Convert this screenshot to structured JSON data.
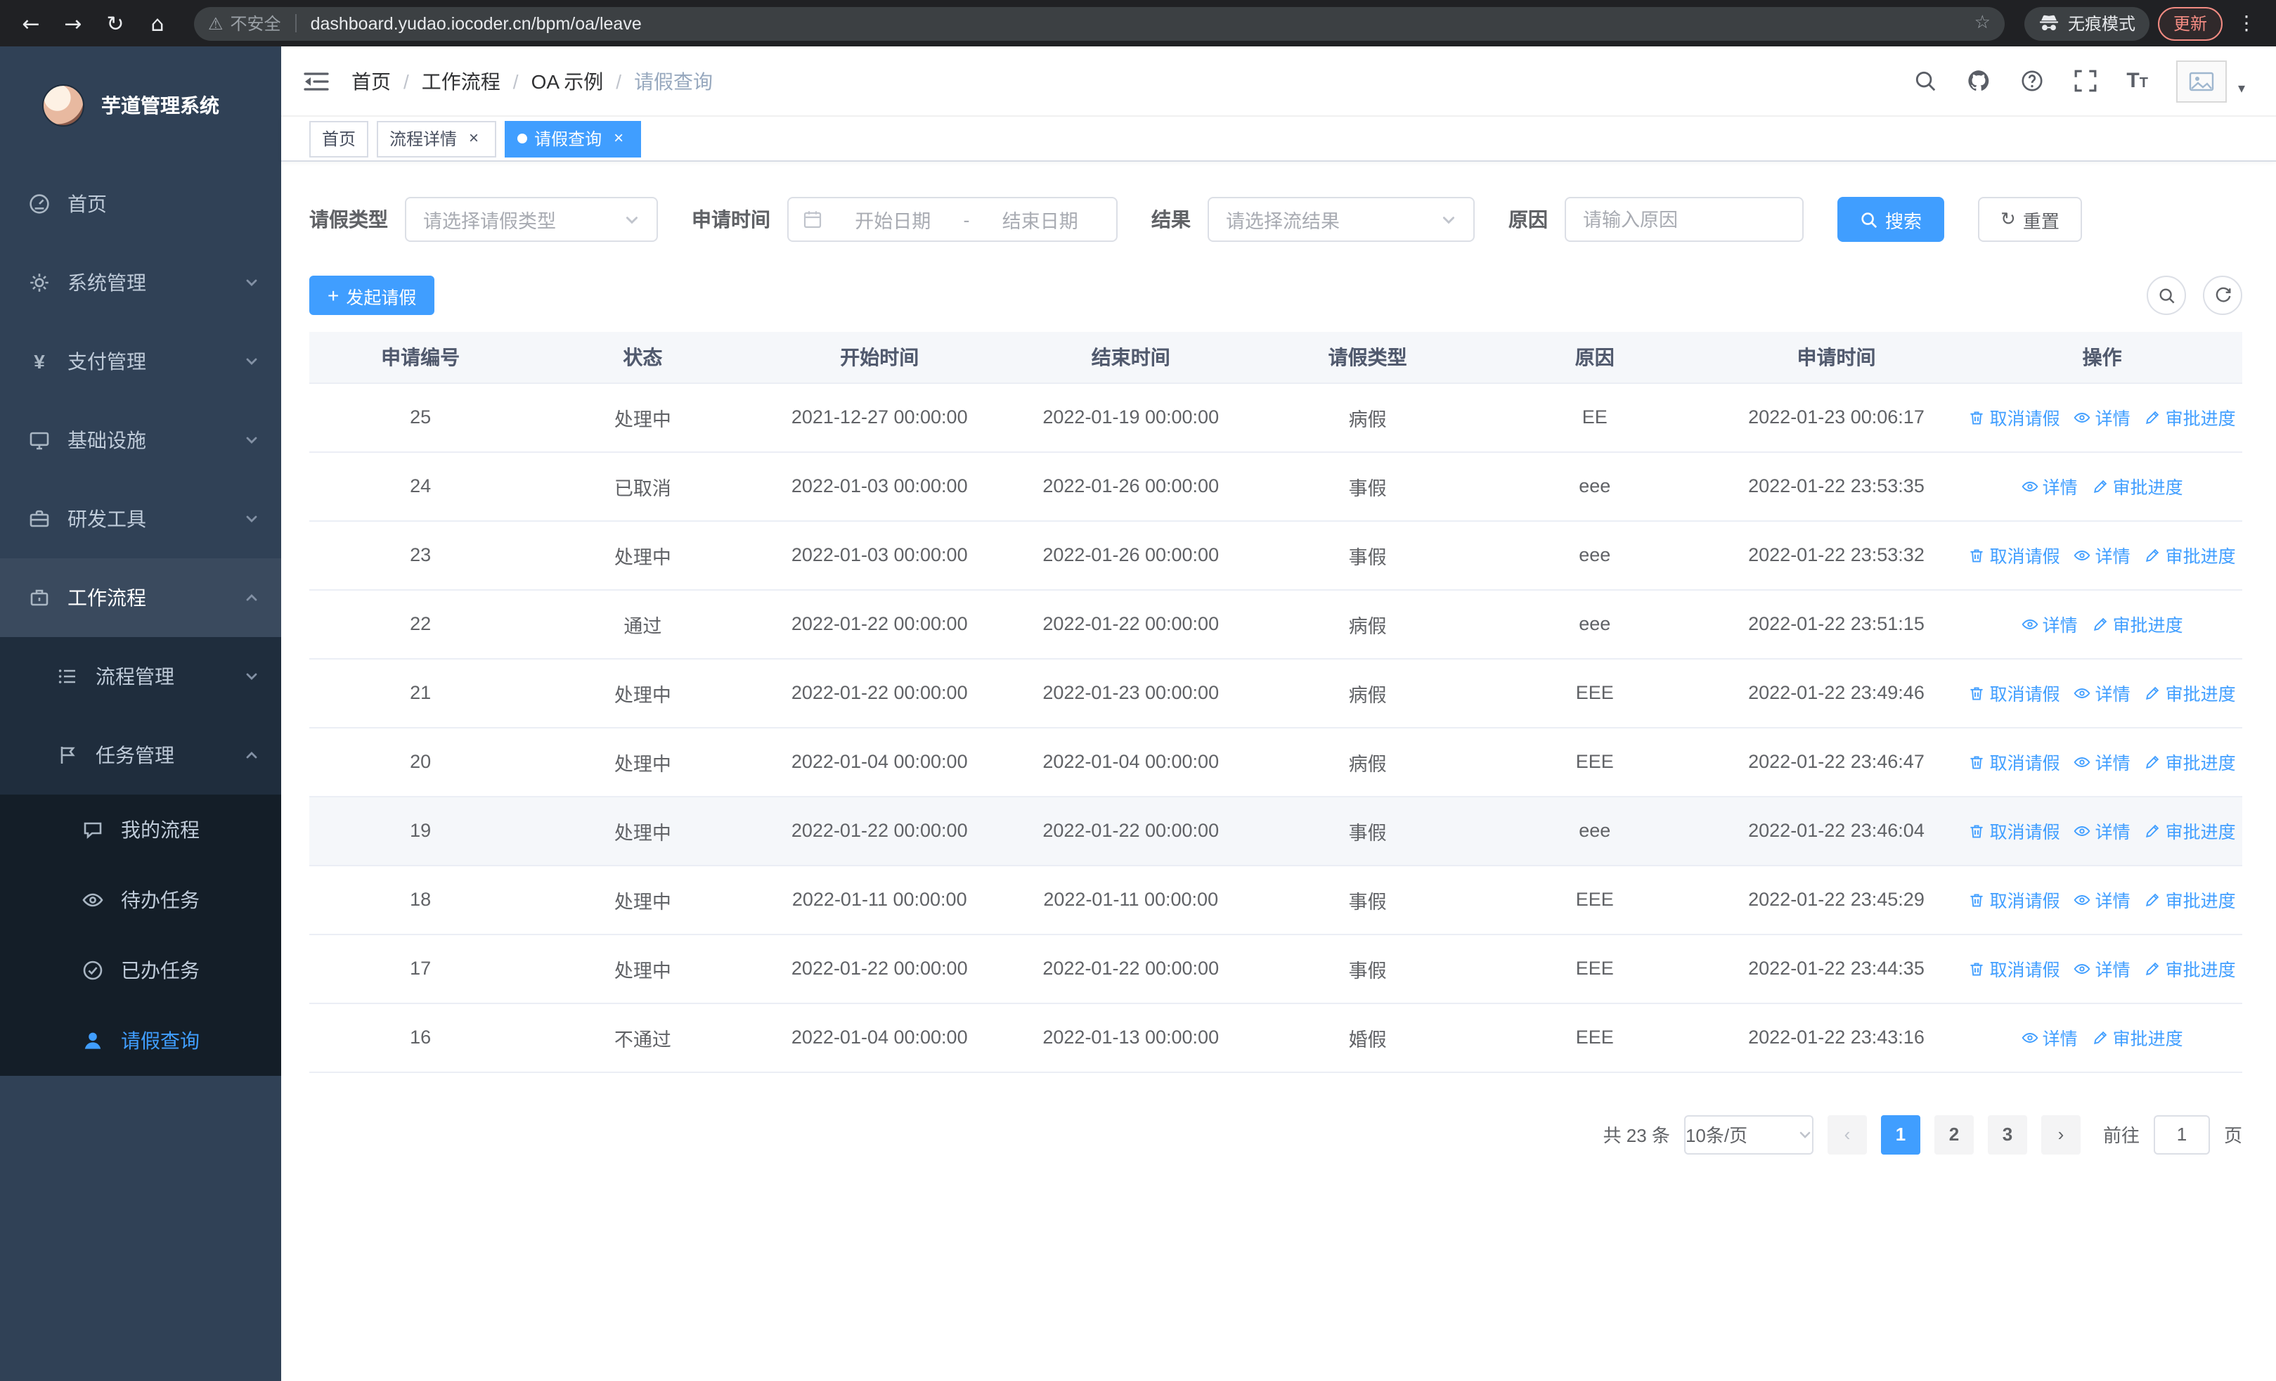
{
  "colors": {
    "accent": "#409eff",
    "sidebar_bg": "#304156",
    "sidebar_sub_bg": "#1f2d3d",
    "chrome_bg": "#202124",
    "danger": "#f28b82"
  },
  "icons": {
    "back": "←",
    "forward": "→",
    "reload": "↻",
    "home": "⌂",
    "warning": "⚠",
    "star": "☆",
    "menu_dots": "⋮",
    "close": "×",
    "prev": "‹",
    "next": "›",
    "plus": "+",
    "caret_down": "▾",
    "font_size": "T",
    "refresh": "↻"
  },
  "browser": {
    "security_warning": "不安全",
    "url": "dashboard.yudao.iocoder.cn/bpm/oa/leave",
    "incognito_label": "无痕模式",
    "update_label": "更新"
  },
  "sidebar": {
    "title": "芋道管理系统",
    "items": [
      {
        "label": "首页"
      },
      {
        "label": "系统管理"
      },
      {
        "label": "支付管理"
      },
      {
        "label": "基础设施"
      },
      {
        "label": "研发工具"
      },
      {
        "label": "工作流程"
      },
      {
        "label": "流程管理"
      },
      {
        "label": "任务管理"
      },
      {
        "label": "我的流程"
      },
      {
        "label": "待办任务"
      },
      {
        "label": "已办任务"
      },
      {
        "label": "请假查询"
      }
    ]
  },
  "header": {
    "breadcrumb": [
      "首页",
      "工作流程",
      "OA 示例",
      "请假查询"
    ]
  },
  "tabs": [
    {
      "label": "首页"
    },
    {
      "label": "流程详情"
    },
    {
      "label": "请假查询"
    }
  ],
  "filters": {
    "leave_type_label": "请假类型",
    "leave_type_placeholder": "请选择请假类型",
    "apply_time_label": "申请时间",
    "start_date_placeholder": "开始日期",
    "range_separator": "-",
    "end_date_placeholder": "结束日期",
    "result_label": "结果",
    "result_placeholder": "请选择流结果",
    "reason_label": "原因",
    "reason_placeholder": "请输入原因",
    "search_label": "搜索",
    "reset_label": "重置"
  },
  "toolbar": {
    "create_label": "发起请假"
  },
  "table": {
    "columns": [
      "申请编号",
      "状态",
      "开始时间",
      "结束时间",
      "请假类型",
      "原因",
      "申请时间",
      "操作"
    ],
    "action_labels": {
      "cancel": "取消请假",
      "detail": "详情",
      "progress": "审批进度"
    },
    "rows": [
      {
        "id": "25",
        "status": "处理中",
        "start": "2021-12-27 00:00:00",
        "end": "2022-01-19 00:00:00",
        "type": "病假",
        "reason": "EE",
        "applied": "2022-01-23 00:06:17",
        "actions": [
          "cancel",
          "detail",
          "progress"
        ]
      },
      {
        "id": "24",
        "status": "已取消",
        "start": "2022-01-03 00:00:00",
        "end": "2022-01-26 00:00:00",
        "type": "事假",
        "reason": "eee",
        "applied": "2022-01-22 23:53:35",
        "actions": [
          "detail",
          "progress"
        ]
      },
      {
        "id": "23",
        "status": "处理中",
        "start": "2022-01-03 00:00:00",
        "end": "2022-01-26 00:00:00",
        "type": "事假",
        "reason": "eee",
        "applied": "2022-01-22 23:53:32",
        "actions": [
          "cancel",
          "detail",
          "progress"
        ]
      },
      {
        "id": "22",
        "status": "通过",
        "start": "2022-01-22 00:00:00",
        "end": "2022-01-22 00:00:00",
        "type": "病假",
        "reason": "eee",
        "applied": "2022-01-22 23:51:15",
        "actions": [
          "detail",
          "progress"
        ]
      },
      {
        "id": "21",
        "status": "处理中",
        "start": "2022-01-22 00:00:00",
        "end": "2022-01-23 00:00:00",
        "type": "病假",
        "reason": "EEE",
        "applied": "2022-01-22 23:49:46",
        "actions": [
          "cancel",
          "detail",
          "progress"
        ]
      },
      {
        "id": "20",
        "status": "处理中",
        "start": "2022-01-04 00:00:00",
        "end": "2022-01-04 00:00:00",
        "type": "病假",
        "reason": "EEE",
        "applied": "2022-01-22 23:46:47",
        "actions": [
          "cancel",
          "detail",
          "progress"
        ]
      },
      {
        "id": "19",
        "status": "处理中",
        "start": "2022-01-22 00:00:00",
        "end": "2022-01-22 00:00:00",
        "type": "事假",
        "reason": "eee",
        "applied": "2022-01-22 23:46:04",
        "actions": [
          "cancel",
          "detail",
          "progress"
        ],
        "highlighted": true
      },
      {
        "id": "18",
        "status": "处理中",
        "start": "2022-01-11 00:00:00",
        "end": "2022-01-11 00:00:00",
        "type": "事假",
        "reason": "EEE",
        "applied": "2022-01-22 23:45:29",
        "actions": [
          "cancel",
          "detail",
          "progress"
        ]
      },
      {
        "id": "17",
        "status": "处理中",
        "start": "2022-01-22 00:00:00",
        "end": "2022-01-22 00:00:00",
        "type": "事假",
        "reason": "EEE",
        "applied": "2022-01-22 23:44:35",
        "actions": [
          "cancel",
          "detail",
          "progress"
        ]
      },
      {
        "id": "16",
        "status": "不通过",
        "start": "2022-01-04 00:00:00",
        "end": "2022-01-13 00:00:00",
        "type": "婚假",
        "reason": "EEE",
        "applied": "2022-01-22 23:43:16",
        "actions": [
          "detail",
          "progress"
        ]
      }
    ]
  },
  "pagination": {
    "total_text": "共 23 条",
    "page_size": "10条/页",
    "pages": [
      "1",
      "2",
      "3"
    ],
    "active_page": "1",
    "goto_label": "前往",
    "goto_value": "1",
    "goto_suffix": "页"
  }
}
